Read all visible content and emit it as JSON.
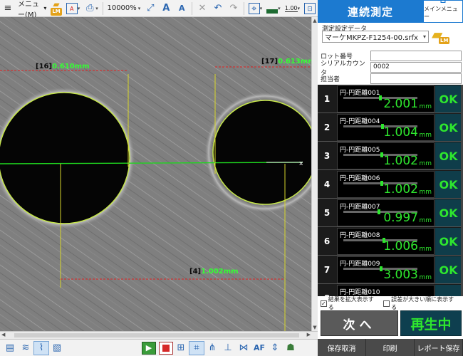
{
  "toolbar": {
    "menu_label": "メニュー(M)",
    "menu_arrow": "▾",
    "lm_badge": "LM",
    "zoom_level": "10000%",
    "scale_value": "1.00"
  },
  "viewer": {
    "measurements": [
      {
        "id": "[16]",
        "value": "0.610mm"
      },
      {
        "id": "[17]",
        "value": "0.613mm"
      },
      {
        "id": "[4]",
        "value": "1.002mm"
      }
    ],
    "marker_x": "x"
  },
  "panel": {
    "title": "連続測定",
    "main_menu_label": "メインメニュー",
    "setting_label": "測定設定データ",
    "setting_value": "マーケMKPZ-F1254-00.srfx",
    "lot_label": "ロット番号",
    "lot_value": "",
    "serial_label": "シリアルカウンタ",
    "serial_value": "0002",
    "operator_label": "担当者",
    "operator_value": ""
  },
  "results": [
    {
      "index": "1",
      "name": "円-円距離001",
      "value": "2.001",
      "unit": "mm",
      "status": "OK"
    },
    {
      "index": "2",
      "name": "円-円距離004",
      "value": "1.004",
      "unit": "mm",
      "status": "OK"
    },
    {
      "index": "3",
      "name": "円-円距離005",
      "value": "1.002",
      "unit": "mm",
      "status": "OK"
    },
    {
      "index": "4",
      "name": "円-円距離006",
      "value": "1.002",
      "unit": "mm",
      "status": "OK"
    },
    {
      "index": "5",
      "name": "円-円距離007",
      "value": "0.997",
      "unit": "mm",
      "status": "OK"
    },
    {
      "index": "6",
      "name": "円-円距離008",
      "value": "1.006",
      "unit": "mm",
      "status": "OK"
    },
    {
      "index": "7",
      "name": "円-円距離009",
      "value": "3.003",
      "unit": "mm",
      "status": "OK"
    },
    {
      "index": "8",
      "name": "円-円距離010",
      "value": "",
      "unit": "",
      "status": ""
    }
  ],
  "options": {
    "enlarge_label": "結果を拡大表示する",
    "enlarge_checked": "✓",
    "error_order_label": "誤差が大きい順に表示する"
  },
  "buttons": {
    "next": "次へ",
    "playback": "再生中",
    "cancel_save": "保存取消",
    "print": "印刷",
    "report_save": "レポート保存"
  },
  "bottom_toolbar": {
    "af_label": "AF"
  },
  "colors": {
    "accent": "#1c7ad0",
    "ok_green": "#2ee62e",
    "measure_green": "#34ff34",
    "dim_red": "#e02020"
  }
}
